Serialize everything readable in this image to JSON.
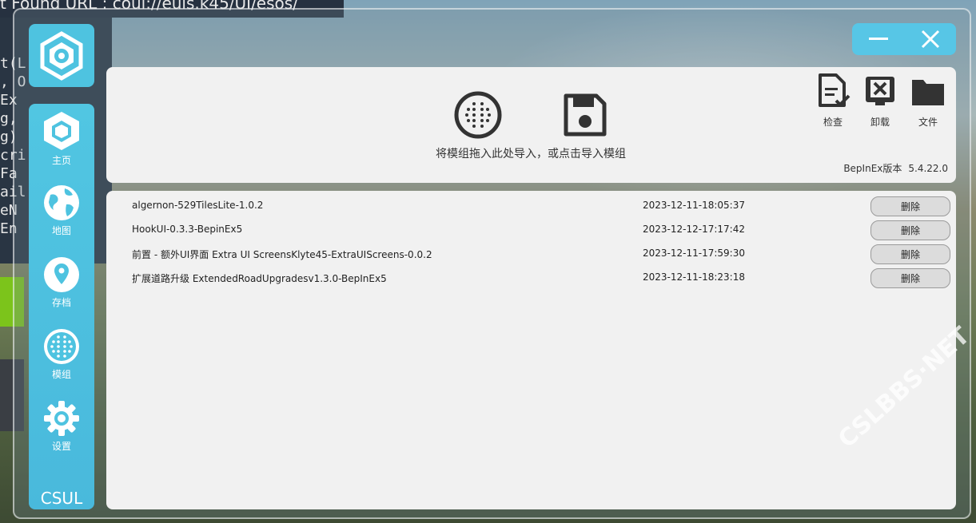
{
  "background": {
    "terminal_title": "t Found URL : coui://euis.k45/UI/esos/",
    "terminal_lines": [
      "t(L",
      ", O",
      "Ex",
      "g,",
      "g)",
      "cri",
      "Fa",
      "ail",
      "eN",
      "En"
    ],
    "watermark": "CSLBBS·NET"
  },
  "sidebar": {
    "items": [
      {
        "label": "主页",
        "icon": "home-hex-icon"
      },
      {
        "label": "地图",
        "icon": "globe-icon"
      },
      {
        "label": "存档",
        "icon": "location-pin-icon"
      },
      {
        "label": "模组",
        "icon": "dots-grid-icon"
      },
      {
        "label": "设置",
        "icon": "gear-icon"
      }
    ],
    "brand": "CSUL"
  },
  "window_controls": {
    "minimize": "minimize-icon",
    "close": "close-icon"
  },
  "top_panel": {
    "drop_hint": "将模组拖入此处导入，或点击导入模组",
    "tools": [
      {
        "label": "检查",
        "icon": "check-document-icon"
      },
      {
        "label": "卸载",
        "icon": "uninstall-icon"
      },
      {
        "label": "文件",
        "icon": "folder-icon"
      }
    ],
    "version_label": "BepInEx版本",
    "version_value": "5.4.22.0"
  },
  "mods": [
    {
      "name": "algernon-529TilesLite-1.0.2",
      "date": "2023-12-11-18:05:37",
      "action": "删除"
    },
    {
      "name": "HookUI-0.3.3-BepinEx5",
      "date": "2023-12-12-17:17:42",
      "action": "删除"
    },
    {
      "name": "前置 - 额外UI界面 Extra UI ScreensKlyte45-ExtraUIScreens-0.0.2",
      "date": "2023-12-11-17:59:30",
      "action": "删除"
    },
    {
      "name": "扩展道路升级 ExtendedRoadUpgradesv1.3.0-BepInEx5",
      "date": "2023-12-11-18:23:18",
      "action": "删除"
    }
  ],
  "colors": {
    "accent": "#4ec3e0",
    "panel": "#f1f1f1",
    "icon": "#333333"
  }
}
